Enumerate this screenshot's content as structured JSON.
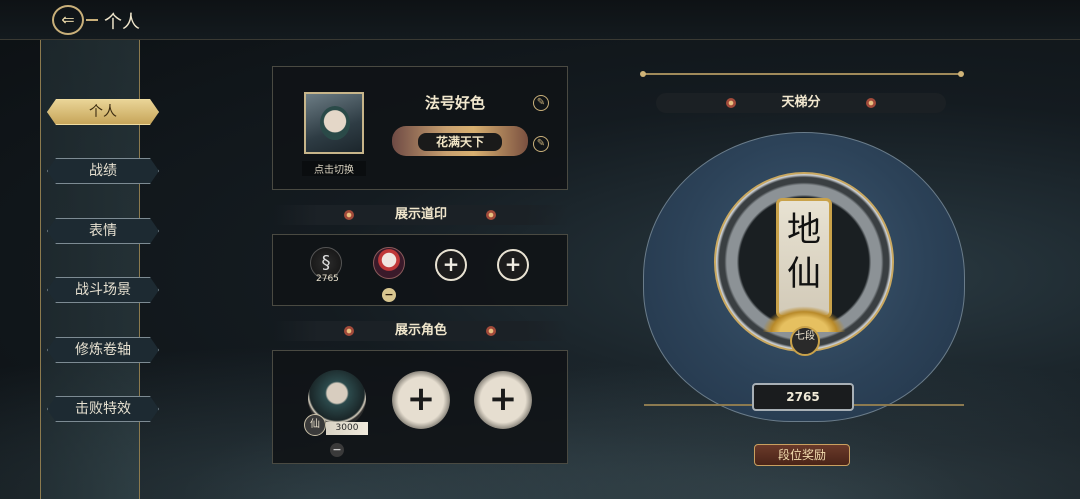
{
  "header": {
    "title": "个人",
    "back_icon": "back-arrow-icon"
  },
  "sidebar": {
    "items": [
      {
        "label": "个人",
        "active": true
      },
      {
        "label": "战绩",
        "active": false
      },
      {
        "label": "表情",
        "active": false
      },
      {
        "label": "战斗场景",
        "active": false
      },
      {
        "label": "修炼卷轴",
        "active": false
      },
      {
        "label": "击败特效",
        "active": false
      }
    ]
  },
  "profile": {
    "avatar_caption": "点击切换",
    "nickname": "法号好色",
    "title_badge": "花满天下",
    "edit_icon": "brush-icon"
  },
  "seals": {
    "section_title": "展示道印",
    "items": [
      {
        "type": "snake-seal",
        "value": "2765"
      },
      {
        "type": "mask-seal"
      },
      {
        "type": "empty",
        "symbol": "+"
      },
      {
        "type": "empty",
        "symbol": "+"
      }
    ],
    "remove_symbol": "−"
  },
  "characters": {
    "section_title": "展示角色",
    "items": [
      {
        "type": "character",
        "rank_glyph": "仙",
        "score": "3000"
      },
      {
        "type": "empty",
        "symbol": "+"
      },
      {
        "type": "empty",
        "symbol": "+"
      }
    ],
    "remove_symbol": "−"
  },
  "ladder": {
    "title": "天梯分",
    "rank_name": "地仙",
    "rank_level": "七段",
    "score": "2765",
    "reward_button": "段位奖励"
  },
  "colors": {
    "accent_gold": "#c9b07a",
    "active_tab": "#e9d496",
    "disc_blue": "#2c4258"
  }
}
